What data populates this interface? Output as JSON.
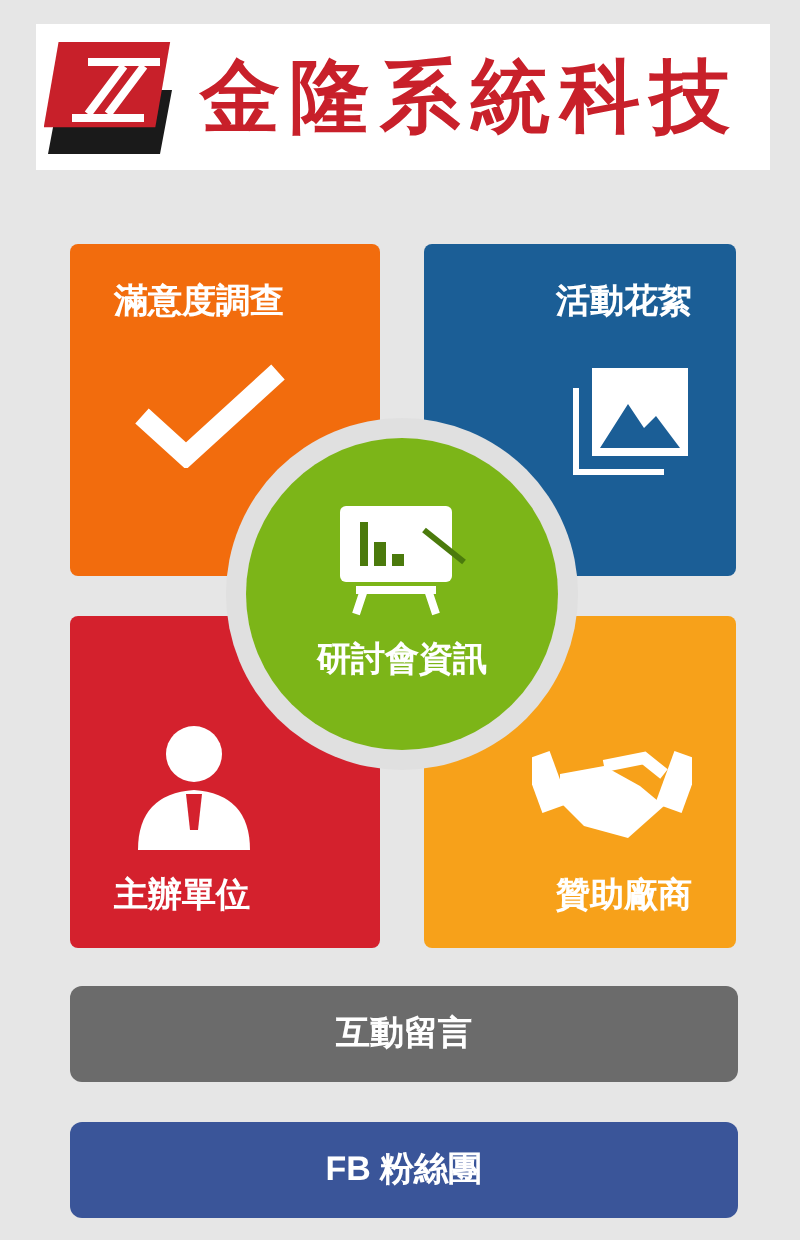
{
  "logo": {
    "text": "金隆系統科技"
  },
  "tiles": [
    {
      "label": "滿意度調查",
      "kind": "check",
      "color": "#f26c0d"
    },
    {
      "label": "活動花絮",
      "kind": "gallery",
      "color": "#1b5e96"
    },
    {
      "label": "主辦單位",
      "kind": "person",
      "color": "#d4212d"
    },
    {
      "label": "贊助廠商",
      "kind": "handshake",
      "color": "#f7a11a"
    }
  ],
  "center": {
    "label": "研討會資訊"
  },
  "buttons": [
    {
      "label": "互動留言",
      "color": "#6b6b6b"
    },
    {
      "label": "FB 粉絲團",
      "color": "#3a5599"
    }
  ]
}
